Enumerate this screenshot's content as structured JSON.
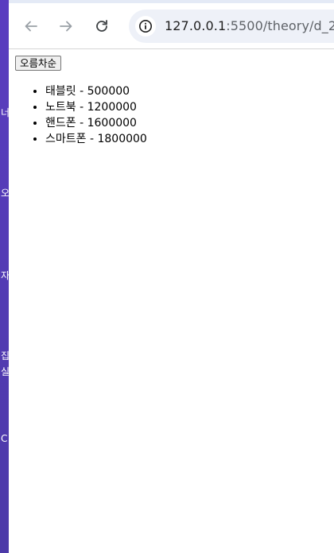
{
  "background_colors": {
    "desktop_strip": "#5b3fb8",
    "page": "#ffffff",
    "omnibox": "#eef1f8"
  },
  "desktop_strip": {
    "fragments": [
      "너",
      "오",
      "자",
      "집",
      "실",
      "C"
    ]
  },
  "browser": {
    "back_icon": "arrow-left-icon",
    "forward_icon": "arrow-right-icon",
    "reload_icon": "reload-icon",
    "site_info_icon": "info-icon",
    "url_host": "127.0.0.1",
    "url_rest": ":5500/theory/d_2_"
  },
  "page": {
    "sort_button_label": "오름차순",
    "items": [
      "태블릿 - 500000",
      "노트북 - 1200000",
      "핸드폰 - 1600000",
      "스마트폰 - 1800000"
    ]
  }
}
